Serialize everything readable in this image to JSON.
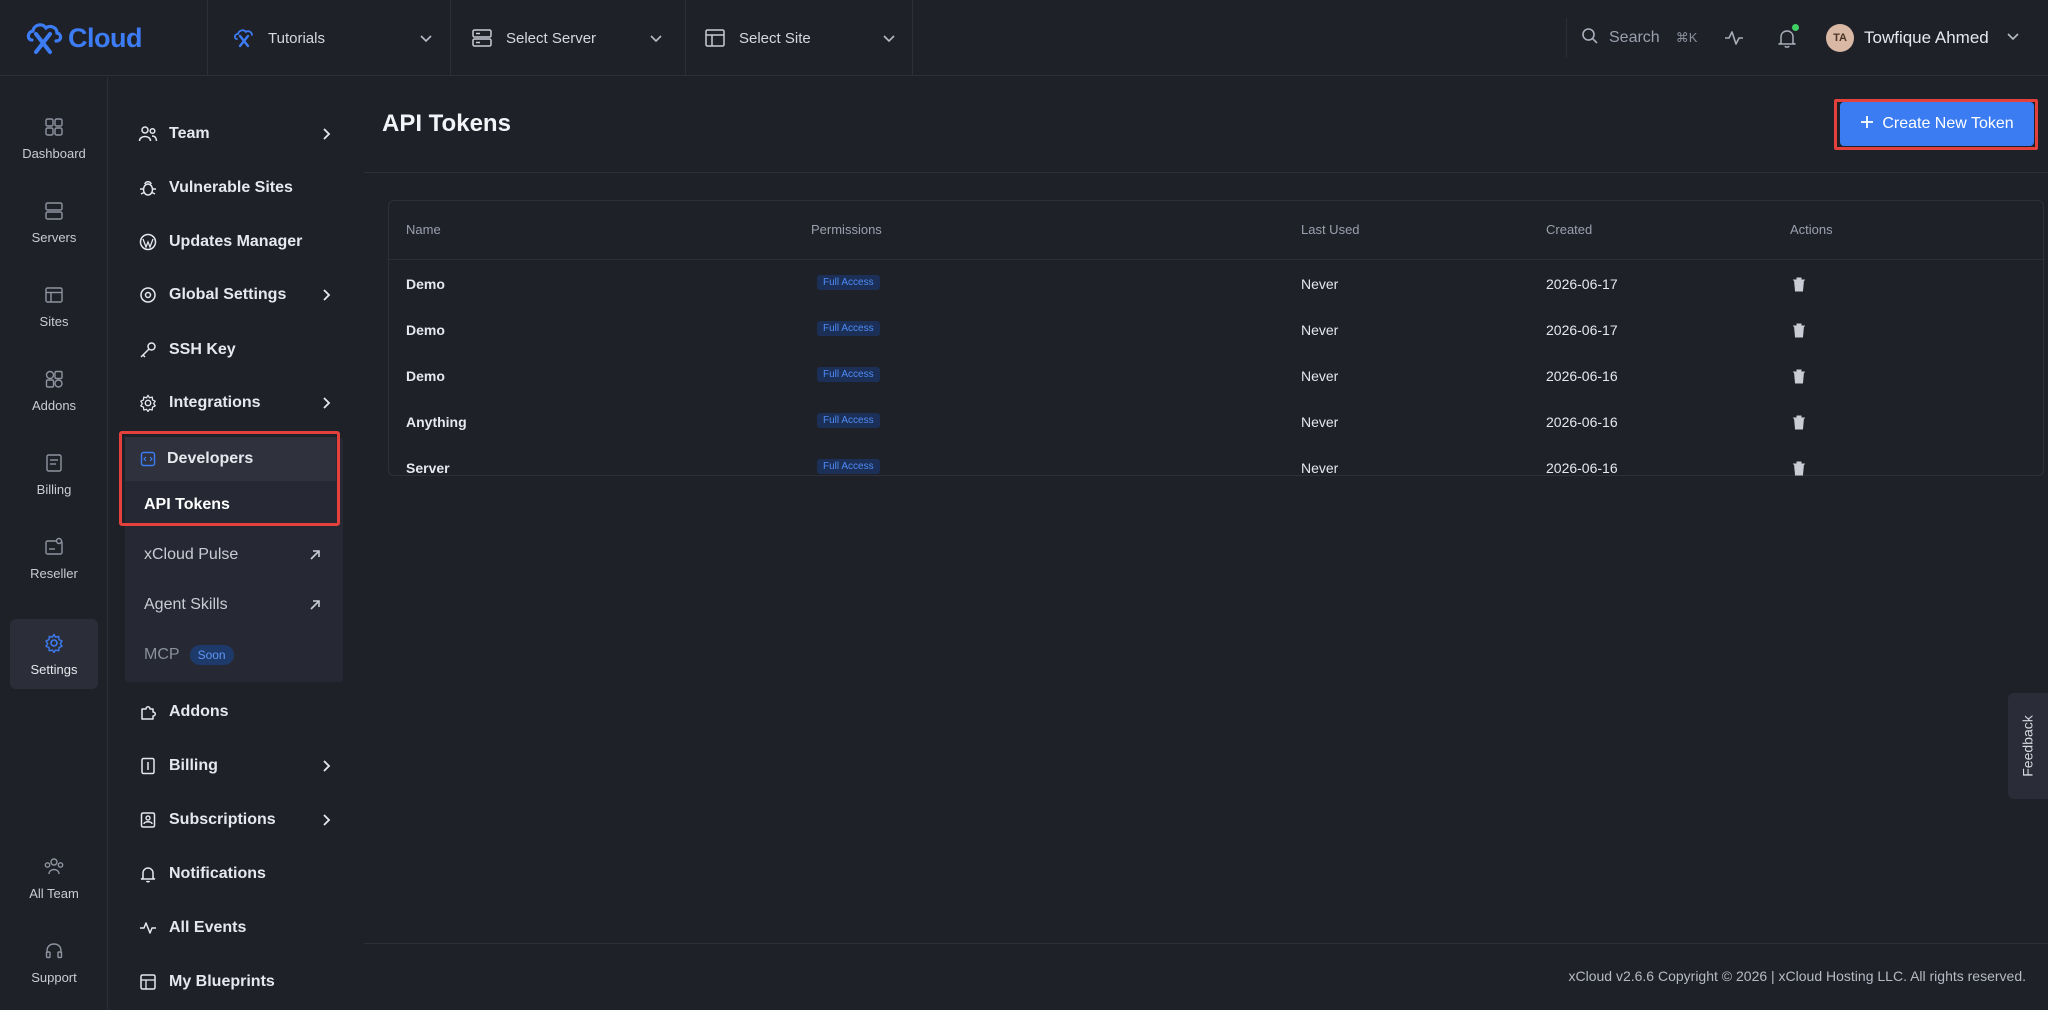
{
  "brand": {
    "name": "Cloud"
  },
  "topbar": {
    "selectors": [
      {
        "label": "Tutorials",
        "icon": "xcloud-icon"
      },
      {
        "label": "Select Server",
        "icon": "server-icon"
      },
      {
        "label": "Select Site",
        "icon": "site-icon"
      }
    ],
    "search_label": "Search",
    "search_shortcut": "⌘K",
    "user": {
      "initials": "TA",
      "name": "Towfique Ahmed"
    }
  },
  "rail": {
    "items": [
      {
        "label": "Dashboard",
        "icon": "dashboard-icon"
      },
      {
        "label": "Servers",
        "icon": "server-icon"
      },
      {
        "label": "Sites",
        "icon": "site-icon"
      },
      {
        "label": "Addons",
        "icon": "addons-icon"
      },
      {
        "label": "Billing",
        "icon": "billing-icon"
      },
      {
        "label": "Reseller",
        "icon": "reseller-icon"
      },
      {
        "label": "Settings",
        "icon": "settings-icon",
        "active": true
      },
      {
        "label": "All Team",
        "icon": "team-icon"
      },
      {
        "label": "Support",
        "icon": "headset-icon"
      }
    ]
  },
  "menu": {
    "items": [
      {
        "label": "Team",
        "icon": "team-icon",
        "chevron": true
      },
      {
        "label": "Vulnerable Sites",
        "icon": "bug-icon"
      },
      {
        "label": "Updates Manager",
        "icon": "wordpress-icon"
      },
      {
        "label": "Global Settings",
        "icon": "globe-gear-icon",
        "chevron": true
      },
      {
        "label": "SSH Key",
        "icon": "key-icon"
      },
      {
        "label": "Integrations",
        "icon": "gear-icon",
        "chevron": true
      }
    ],
    "developers": {
      "label": "Developers",
      "icon": "code-icon",
      "children": [
        {
          "label": "API Tokens",
          "active": true
        },
        {
          "label": "xCloud Pulse",
          "external": true
        },
        {
          "label": "Agent Skills",
          "external": true
        },
        {
          "label": "MCP",
          "badge": "Soon"
        }
      ]
    },
    "items_after": [
      {
        "label": "Addons",
        "icon": "puzzle-icon"
      },
      {
        "label": "Billing",
        "icon": "billing-icon",
        "chevron": true
      },
      {
        "label": "Subscriptions",
        "icon": "subscription-icon",
        "chevron": true
      },
      {
        "label": "Notifications",
        "icon": "bell-icon"
      },
      {
        "label": "All Events",
        "icon": "activity-icon"
      },
      {
        "label": "My Blueprints",
        "icon": "blueprint-icon"
      }
    ]
  },
  "main": {
    "title": "API Tokens",
    "create_button": "Create New Token",
    "table": {
      "columns": [
        "Name",
        "Permissions",
        "Last Used",
        "Created",
        "Actions"
      ],
      "rows": [
        {
          "name": "Demo",
          "permission": "Full Access",
          "last_used": "Never",
          "created": "2026-06-17"
        },
        {
          "name": "Demo",
          "permission": "Full Access",
          "last_used": "Never",
          "created": "2026-06-17"
        },
        {
          "name": "Demo",
          "permission": "Full Access",
          "last_used": "Never",
          "created": "2026-06-16"
        },
        {
          "name": "Anything",
          "permission": "Full Access",
          "last_used": "Never",
          "created": "2026-06-16"
        },
        {
          "name": "Server",
          "permission": "Full Access",
          "last_used": "Never",
          "created": "2026-06-16"
        }
      ]
    },
    "footer": "xCloud v2.6.6 Copyright © 2026 | xCloud Hosting LLC. All rights reserved."
  },
  "feedback_label": "Feedback",
  "colors": {
    "accent": "#3b7cf3",
    "highlight": "#e4413c",
    "background": "#1f2129"
  }
}
